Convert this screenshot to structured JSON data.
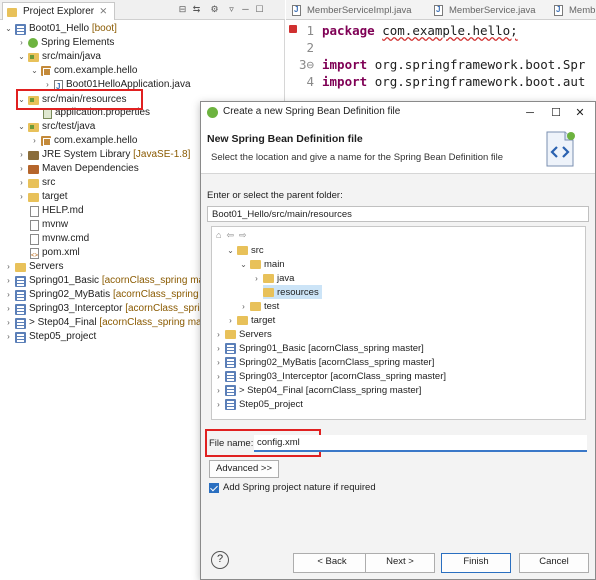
{
  "explorer": {
    "tab_title": "Project Explorer",
    "tab_close": "⨯",
    "tree": [
      {
        "label": "Boot01_Hello",
        "suffix": "[boot]"
      },
      {
        "label": "Spring Elements"
      },
      {
        "label": "src/main/java"
      },
      {
        "label": "com.example.hello"
      },
      {
        "label": "Boot01HelloApplication.java"
      },
      {
        "label": "src/main/resources"
      },
      {
        "label": "application.properties"
      },
      {
        "label": "src/test/java"
      },
      {
        "label": "com.example.hello"
      },
      {
        "label": "JRE System Library",
        "suffix": "[JavaSE-1.8]"
      },
      {
        "label": "Maven Dependencies"
      },
      {
        "label": "src"
      },
      {
        "label": "target"
      },
      {
        "label": "HELP.md"
      },
      {
        "label": "mvnw"
      },
      {
        "label": "mvnw.cmd"
      },
      {
        "label": "pom.xml"
      },
      {
        "label": "Servers"
      },
      {
        "label": "Spring01_Basic",
        "suffix": "[acornClass_spring master]"
      },
      {
        "label": "Spring02_MyBatis",
        "suffix": "[acornClass_spring master]"
      },
      {
        "label": "Spring03_Interceptor",
        "suffix": "[acornClass_spring master]"
      },
      {
        "label": "> Step04_Final",
        "suffix": "[acornClass_spring master]"
      },
      {
        "label": "Step05_project"
      }
    ]
  },
  "editor": {
    "tabs": [
      "MemberServiceImpl.java",
      "MemberService.java",
      "Memb"
    ],
    "lines": [
      {
        "num": "1",
        "keyword": "package",
        "rest": "com.example.hello;"
      },
      {
        "num": "2",
        "keyword": "",
        "rest": ""
      },
      {
        "num": "3⊖",
        "keyword": "import",
        "rest": "org.springframework.boot.Spr"
      },
      {
        "num": "4",
        "keyword": "import",
        "rest": "org.springframework.boot.aut"
      }
    ]
  },
  "dialog": {
    "title": "Create a new Spring Bean Definition file",
    "minimize": "─",
    "maximize": "☐",
    "close": "✕",
    "heading": "New Spring Bean Definition file",
    "subtitle": "Select the location and give a name for the Spring Bean Definition file",
    "parent_label": "Enter or select the parent folder:",
    "parent_value": "Boot01_Hello/src/main/resources",
    "tree": [
      {
        "label": "src"
      },
      {
        "label": "main"
      },
      {
        "label": "java"
      },
      {
        "label": "resources"
      },
      {
        "label": "test"
      },
      {
        "label": "target"
      },
      {
        "label": "Servers"
      },
      {
        "label": "Spring01_Basic [acornClass_spring master]"
      },
      {
        "label": "Spring02_MyBatis [acornClass_spring master]"
      },
      {
        "label": "Spring03_Interceptor [acornClass_spring master]"
      },
      {
        "label": "> Step04_Final [acornClass_spring master]"
      },
      {
        "label": "Step05_project"
      }
    ],
    "file_name_label": "File name:",
    "file_name_value": "config.xml",
    "advanced_label": "Advanced >>",
    "nature_label": "Add Spring project nature if required",
    "help_label": "?",
    "back_label": "< Back",
    "next_label": "Next >",
    "finish_label": "Finish",
    "cancel_label": "Cancel"
  }
}
